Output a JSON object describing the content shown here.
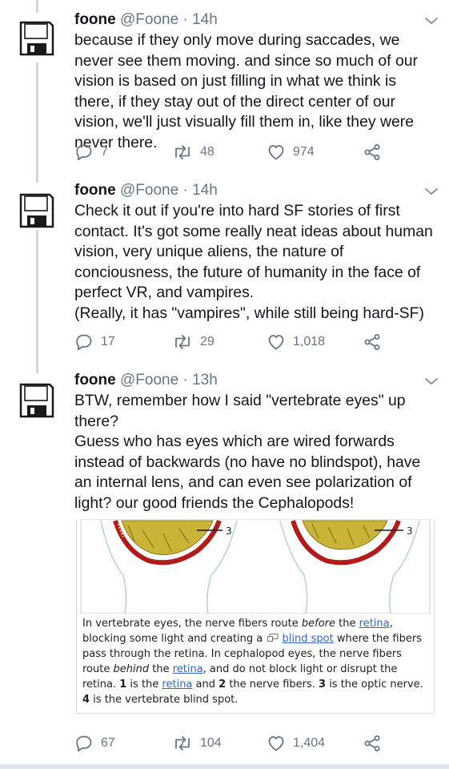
{
  "tweets": [
    {
      "name": "foone",
      "handle": "@Foone",
      "separator": "·",
      "time": "14h",
      "avatar_icon": "floppy-disk-icon",
      "text": "because if they only move during saccades, we never see them moving. and since so much of our vision is based on just filling in what we think is there, if they stay out of the direct center of our vision, we'll just visually fill them in, like they were never there.",
      "replies": "7",
      "retweets": "48",
      "likes": "974"
    },
    {
      "name": "foone",
      "handle": "@Foone",
      "separator": "·",
      "time": "14h",
      "avatar_icon": "floppy-disk-icon",
      "text_paragraphs": [
        "Check it out if you're into hard SF stories of first contact. It's got some really neat ideas about human vision, very unique aliens, the nature of conciousness, the future of humanity in the face of perfect VR, and vampires.",
        "(Really, it has \"vampires\", while still being hard-SF)"
      ],
      "replies": "17",
      "retweets": "29",
      "likes": "1,018"
    },
    {
      "name": "foone",
      "handle": "@Foone",
      "separator": "·",
      "time": "13h",
      "avatar_icon": "floppy-disk-icon",
      "text_paragraphs": [
        "BTW, remember how I said \"vertebrate eyes\" up there?",
        "Guess who has eyes which are wired forwards instead of backwards (no have no blindspot), have an internal lens, and can even see polarization of light? our good friends the Cephalopods!"
      ],
      "embed": {
        "label_left": "3",
        "label_right": "3",
        "caption": {
          "c1": "In vertebrate eyes, the nerve fibers route ",
          "c2": "before",
          "c3": " the ",
          "link_retina_1": "retina",
          "c4": ", blocking some light and creating a ",
          "link_blind_spot": "blind spot",
          "c5": " where the fibers pass through the retina. In cephalopod eyes, the nerve fibers route ",
          "c6": "behind",
          "c7": " the ",
          "link_retina_2": "retina",
          "c8": ", and do not block light or disrupt the retina. ",
          "n1": "1",
          "c9": " is the ",
          "link_retina_3": "retina",
          "c10": " and ",
          "n2": "2",
          "c11": " the nerve fibers. ",
          "n3": "3",
          "c12": " is the optic nerve. ",
          "n4": "4",
          "c13": " is the vertebrate blind spot."
        }
      },
      "replies": "67",
      "retweets": "104",
      "likes": "1,404"
    }
  ],
  "colors": {
    "text": "#14171a",
    "secondary": "#657786",
    "thread_line": "#cfd9de",
    "link": "#3366cc",
    "nerve_red": "#b31b1b",
    "nerve_yellow": "#c9b437",
    "lens_blue": "#b9cfe8"
  }
}
